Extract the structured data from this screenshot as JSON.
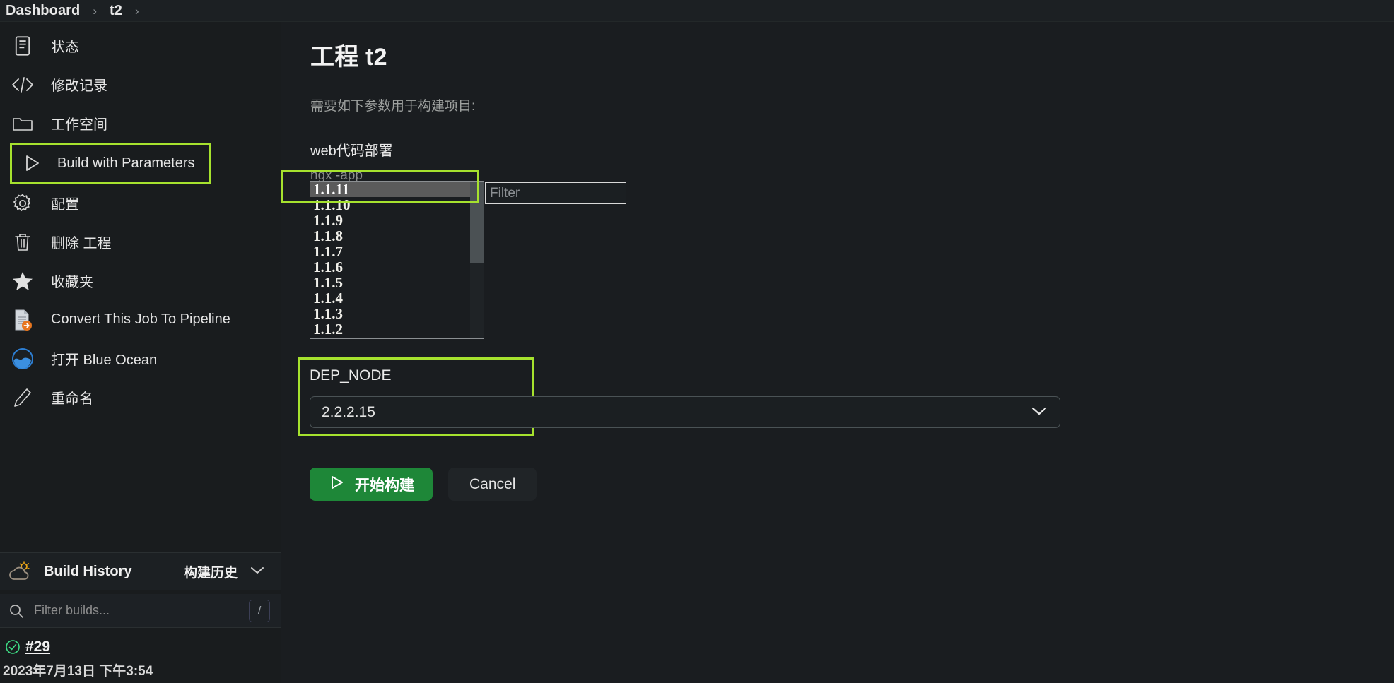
{
  "breadcrumb": {
    "items": [
      "Dashboard",
      "t2"
    ],
    "separator": "›"
  },
  "sidebar": {
    "items": [
      {
        "label": "状态",
        "icon": "document-icon",
        "highlighted": false
      },
      {
        "label": "修改记录",
        "icon": "code-icon",
        "highlighted": false
      },
      {
        "label": "工作空间",
        "icon": "folder-icon",
        "highlighted": false
      },
      {
        "label": "Build with Parameters",
        "icon": "play-icon",
        "highlighted": true
      },
      {
        "label": "配置",
        "icon": "gear-icon",
        "highlighted": false
      },
      {
        "label": "删除 工程",
        "icon": "trash-icon",
        "highlighted": false
      },
      {
        "label": "收藏夹",
        "icon": "star-icon",
        "highlighted": false
      },
      {
        "label": "Convert This Job To Pipeline",
        "icon": "convert-pipeline-icon",
        "highlighted": false
      },
      {
        "label": "打开 Blue Ocean",
        "icon": "blue-ocean-icon",
        "highlighted": false
      },
      {
        "label": "重命名",
        "icon": "pencil-icon",
        "highlighted": false
      }
    ]
  },
  "build_history": {
    "title": "Build History",
    "link_label": "构建历史",
    "collapse_icon": "chevron-down-icon",
    "weather_icon": "weather-sun-cloud-icon",
    "search_icon": "search-icon",
    "filter_placeholder": "Filter builds...",
    "filter_value": "",
    "shortcut_key": "/",
    "builds": [
      {
        "number": "#29",
        "timestamp": "2023年7月13日 下午3:54",
        "status": "success"
      }
    ]
  },
  "main": {
    "title": "工程 t2",
    "description": "需要如下参数用于构建项目:",
    "parameters": [
      {
        "name": "web代码部署",
        "description": "ngx -app",
        "type": "listbox",
        "selected": "1.1.11",
        "options": [
          "1.1.11",
          "1.1.10",
          "1.1.9",
          "1.1.8",
          "1.1.7",
          "1.1.6",
          "1.1.5",
          "1.1.4",
          "1.1.3",
          "1.1.2"
        ],
        "filter_placeholder": "Filter",
        "filter_value": ""
      },
      {
        "name": "DEP_NODE",
        "type": "select",
        "selected": "2.2.2.15",
        "chevron_icon": "chevron-down-icon"
      }
    ],
    "actions": {
      "build_label": "开始构建",
      "build_icon": "play-icon",
      "cancel_label": "Cancel"
    }
  },
  "colors": {
    "highlight_outline": "#a6e22e",
    "build_button": "#1e8738",
    "page_background": "#1a1d20",
    "sidebar_background": "#191c1e",
    "success_status": "#3ddc84"
  }
}
